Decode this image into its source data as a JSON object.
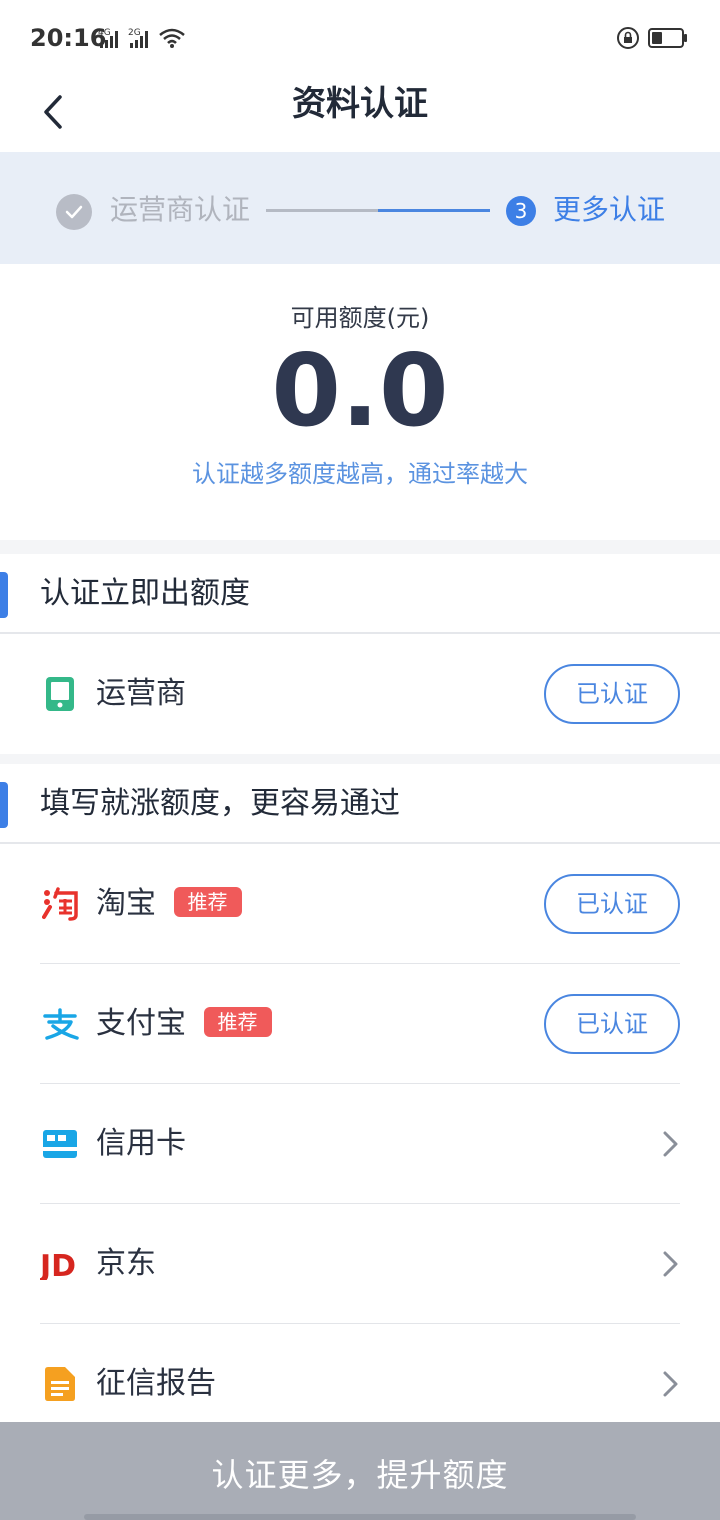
{
  "status_bar": {
    "time": "20:16",
    "net1": "4G",
    "net2": "2G"
  },
  "header": {
    "title": "资料认证",
    "back_icon": "back-arrow-icon"
  },
  "stepper": {
    "step1_label": "运营商认证",
    "step1_status": "completed",
    "step3_number": "3",
    "step3_label": "更多认证"
  },
  "credit": {
    "label": "可用额度(元)",
    "value": "0.0",
    "hint": "认证越多额度越高，通过率越大"
  },
  "section1": {
    "title": "认证立即出额度",
    "items": [
      {
        "label": "运营商",
        "icon": "phone-icon",
        "action": "已认证"
      }
    ]
  },
  "section2": {
    "title": "填写就涨额度，更容易通过",
    "items": [
      {
        "label": "淘宝",
        "tag": "推荐",
        "icon": "taobao-icon",
        "action": "已认证"
      },
      {
        "label": "支付宝",
        "tag": "推荐",
        "icon": "alipay-icon",
        "action": "已认证"
      },
      {
        "label": "信用卡",
        "icon": "credit-card-icon"
      },
      {
        "label": "京东",
        "icon": "jd-icon",
        "icon_text": "JD"
      },
      {
        "label": "征信报告",
        "icon": "report-icon"
      }
    ]
  },
  "bottom_button": "认证更多，提升额度",
  "colors": {
    "accent": "#3d7fe6",
    "tag": "#f05a5a",
    "bottom_bar": "#a9adb6"
  }
}
